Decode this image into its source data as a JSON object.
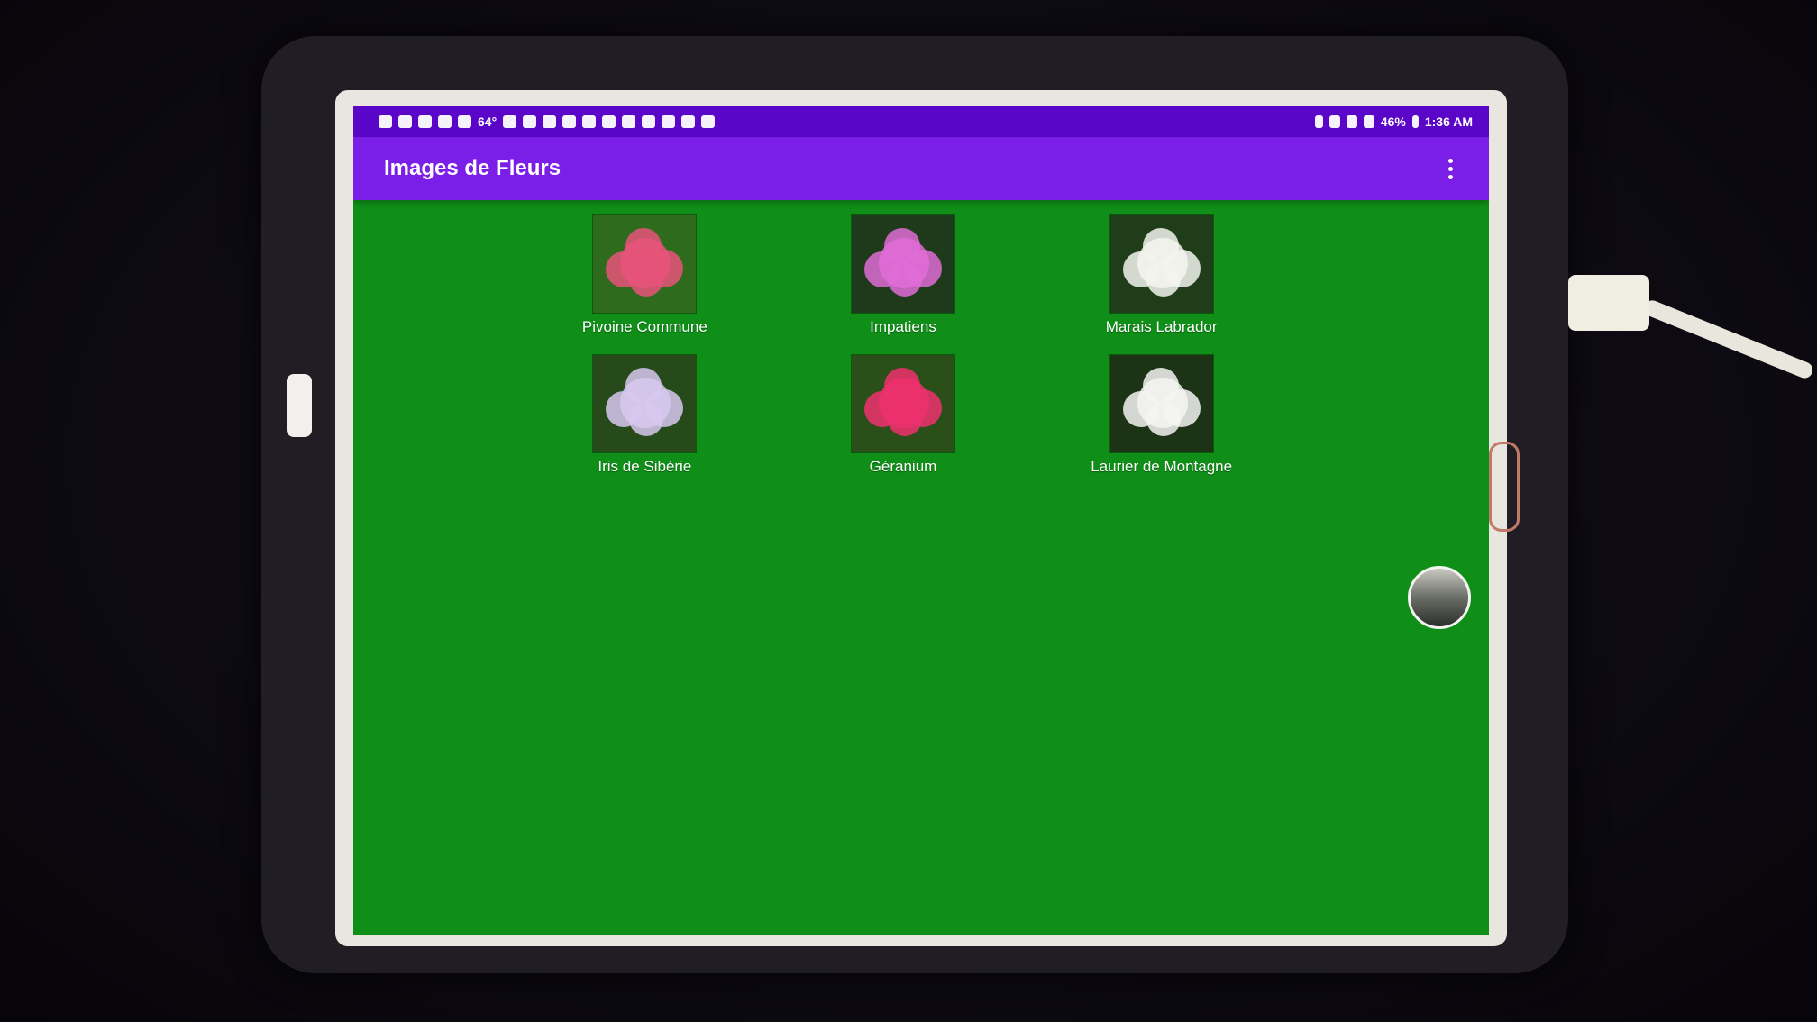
{
  "status_bar": {
    "temperature": "64°",
    "battery": "46%",
    "time": "1:36 AM"
  },
  "app_bar": {
    "title": "Images de Fleurs"
  },
  "flowers": [
    {
      "label": "Pivoine Commune",
      "bg": "#2e6b1c",
      "petal": "#e8527a"
    },
    {
      "label": "Impatiens",
      "bg": "#1f3a1a",
      "petal": "#e06cd8"
    },
    {
      "label": "Marais Labrador",
      "bg": "#203d1a",
      "petal": "#f4f4f0"
    },
    {
      "label": "Iris de Sibérie",
      "bg": "#274a1a",
      "petal": "#d8c8f0"
    },
    {
      "label": "Géranium",
      "bg": "#2a4f18",
      "petal": "#f0306e"
    },
    {
      "label": "Laurier de Montagne",
      "bg": "#1d3316",
      "petal": "#f5f5f2"
    }
  ],
  "colors": {
    "status_bar": "#5a06c8",
    "app_bar": "#7b1fe8",
    "background": "#0f8f17"
  }
}
